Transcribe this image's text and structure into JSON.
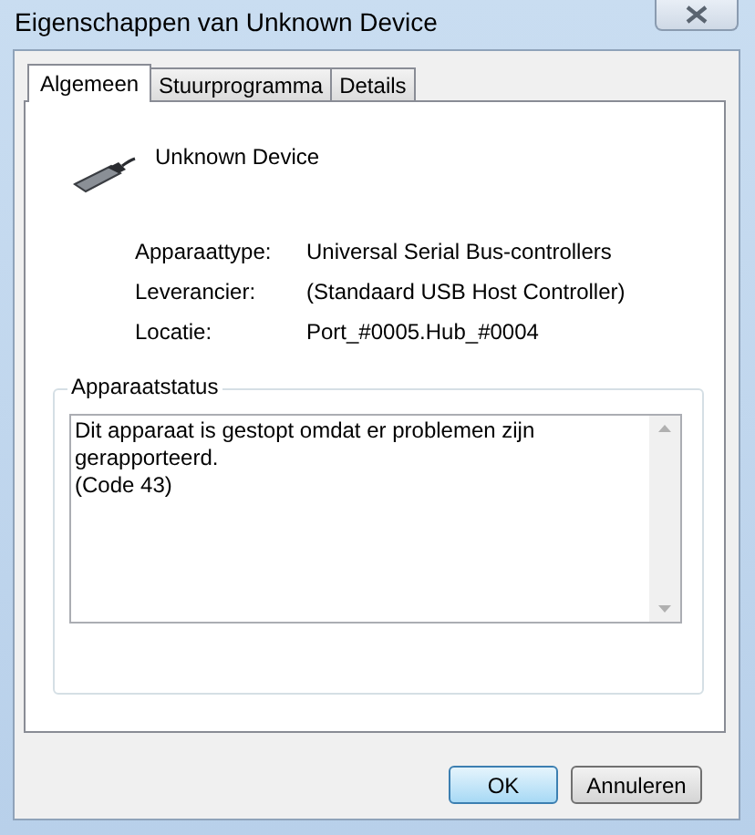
{
  "window": {
    "title": "Eigenschappen van Unknown Device"
  },
  "tabs": [
    {
      "label": "Algemeen",
      "selected": true
    },
    {
      "label": "Stuurprogramma",
      "selected": false
    },
    {
      "label": "Details",
      "selected": false
    }
  ],
  "device": {
    "name": "Unknown Device"
  },
  "properties": [
    {
      "label": "Apparaattype:",
      "value": "Universal Serial Bus-controllers"
    },
    {
      "label": "Leverancier:",
      "value": "(Standaard USB Host Controller)"
    },
    {
      "label": "Locatie:",
      "value": "Port_#0005.Hub_#0004"
    }
  ],
  "status": {
    "title": "Apparaatstatus",
    "lines": [
      "Dit apparaat is gestopt omdat er problemen zijn gerapporteerd.",
      "(Code 43)"
    ]
  },
  "buttons": [
    {
      "label": "OK",
      "kind": "default"
    },
    {
      "label": "Annuleren",
      "kind": "normal"
    }
  ]
}
